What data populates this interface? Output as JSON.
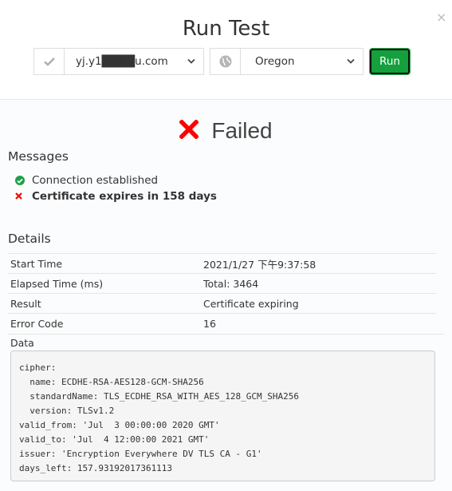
{
  "dialog": {
    "title": "Run Test",
    "close_label": "×"
  },
  "controls": {
    "host_icon": "check-icon",
    "host_value": "yj.y1████u.com",
    "location_icon": "globe-icon",
    "location_value": "Oregon",
    "run_label": "Run"
  },
  "result": {
    "status": "Failed",
    "status_icon": "x-icon",
    "status_color": "#ff0000"
  },
  "messages": {
    "heading": "Messages",
    "items": [
      {
        "type": "success",
        "icon": "check-circle-icon",
        "text": "Connection established"
      },
      {
        "type": "error",
        "icon": "x-icon",
        "text": "Certificate expires in 158 days"
      }
    ]
  },
  "details": {
    "heading": "Details",
    "rows": [
      {
        "label": "Start Time",
        "value": "2021/1/27 下午9:37:58"
      },
      {
        "label": "Elapsed Time (ms)",
        "value": "Total: 3464"
      },
      {
        "label": "Result",
        "value": "Certificate expiring"
      },
      {
        "label": "Error Code",
        "value": "16"
      }
    ],
    "data_label": "Data",
    "data_text": "cipher:\n  name: ECDHE-RSA-AES128-GCM-SHA256\n  standardName: TLS_ECDHE_RSA_WITH_AES_128_GCM_SHA256\n  version: TLSv1.2\nvalid_from: 'Jul  3 00:00:00 2020 GMT'\nvalid_to: 'Jul  4 12:00:00 2021 GMT'\nissuer: 'Encryption Everywhere DV TLS CA - G1'\ndays_left: 157.93192017361113"
  },
  "colors": {
    "run_button": "#14a03c",
    "success": "#1fa04c",
    "error": "#ff0000"
  }
}
